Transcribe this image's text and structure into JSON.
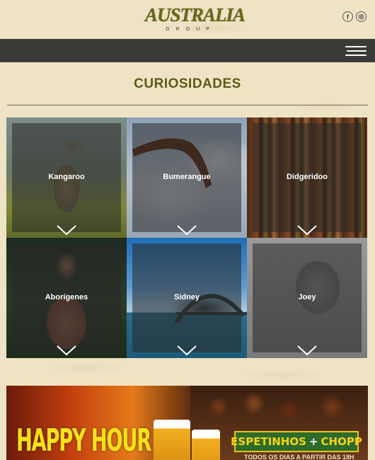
{
  "header": {
    "logo_text": "AUSTRALIA",
    "logo_sub": "GROUP",
    "social": [
      {
        "icon": "facebook-icon",
        "glyph": "f"
      },
      {
        "icon": "instagram-icon",
        "glyph": "◎"
      }
    ]
  },
  "nav": {
    "menu_icon": "hamburger-icon"
  },
  "section": {
    "title": "CURIOSIDADES"
  },
  "tiles": [
    {
      "label": "Kangaroo"
    },
    {
      "label": "Bumerangue"
    },
    {
      "label": "Didgeridoo"
    },
    {
      "label": "Aborígenes"
    },
    {
      "label": "Sidney"
    },
    {
      "label": "Joey"
    }
  ],
  "banner": {
    "headline": "HAPPY HOUR",
    "promo_left": "ESPETINHOS",
    "promo_plus": "+",
    "promo_right": "CHOPP",
    "subtext": "TODOS OS DIAS A PARTIR DAS 18H"
  },
  "colors": {
    "title": "#5c5a18",
    "navbar": "#3a3a36",
    "background": "#efe3c6",
    "logo_accent": "#b8281a",
    "banner_yellow": "#f5e21a"
  }
}
